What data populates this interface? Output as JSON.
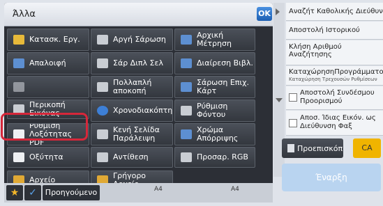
{
  "panel": {
    "title": "Άλλα",
    "ok_label": "OK"
  },
  "tiles": [
    {
      "label": "Κατασκ. Εργ."
    },
    {
      "label": "Αργή Σάρωση"
    },
    {
      "label": "Αρχική Μέτρηση"
    },
    {
      "label": "Απαλοιφή"
    },
    {
      "label": "Σάρ Διπλ Σελ"
    },
    {
      "label": "Διαίρεση Βιβλ."
    },
    {
      "label": "Πολλαπλή αποκοπή"
    },
    {
      "label": "Σάρωση Επιχ. Κάρτ"
    },
    {
      "label": "Περικοπή Εικόνας"
    },
    {
      "label": "Χρονοδιακόπτης"
    },
    {
      "label": "Ρύθμιση Φόντου"
    },
    {
      "label": "Ρύθμιση Λοξότητας PDF"
    },
    {
      "label": "Κενή Σελίδα Παράλειψη"
    },
    {
      "label": "Χρώμα Απόρριψης"
    },
    {
      "label": "Οξύτητα"
    },
    {
      "label": "Αντίθεση"
    },
    {
      "label": "Προσαρ. RGB"
    },
    {
      "label": "Αρχείο"
    },
    {
      "label": "Γρήγορο Αρχείο"
    }
  ],
  "bottom": {
    "star": "★",
    "check": "✓",
    "prev_label": "Προηγούμενο",
    "paper1": "A4",
    "paper2": "A4"
  },
  "right": {
    "items": [
      {
        "label": "Αναζήτ Καθολικής Διεύθυν"
      },
      {
        "label": "Αποστολή Ιστορικού"
      },
      {
        "label": "Κλήση Αριθμού Αναζήτησης"
      },
      {
        "label": "ΚαταχώρησηΠρογράμματος",
        "sub": "Καταχώρηση Τρεχουσών Ρυθμίσεων"
      },
      {
        "label": "Αποστολή Συνδέσμου Προορισμού"
      },
      {
        "label": "Αποσ. Ίδιας Εικόν. ως Διεύθυνση Φαξ"
      }
    ],
    "preview_label": "Προεπισκόπ",
    "ca_label": "CA",
    "start_label": "Έναρξη"
  }
}
